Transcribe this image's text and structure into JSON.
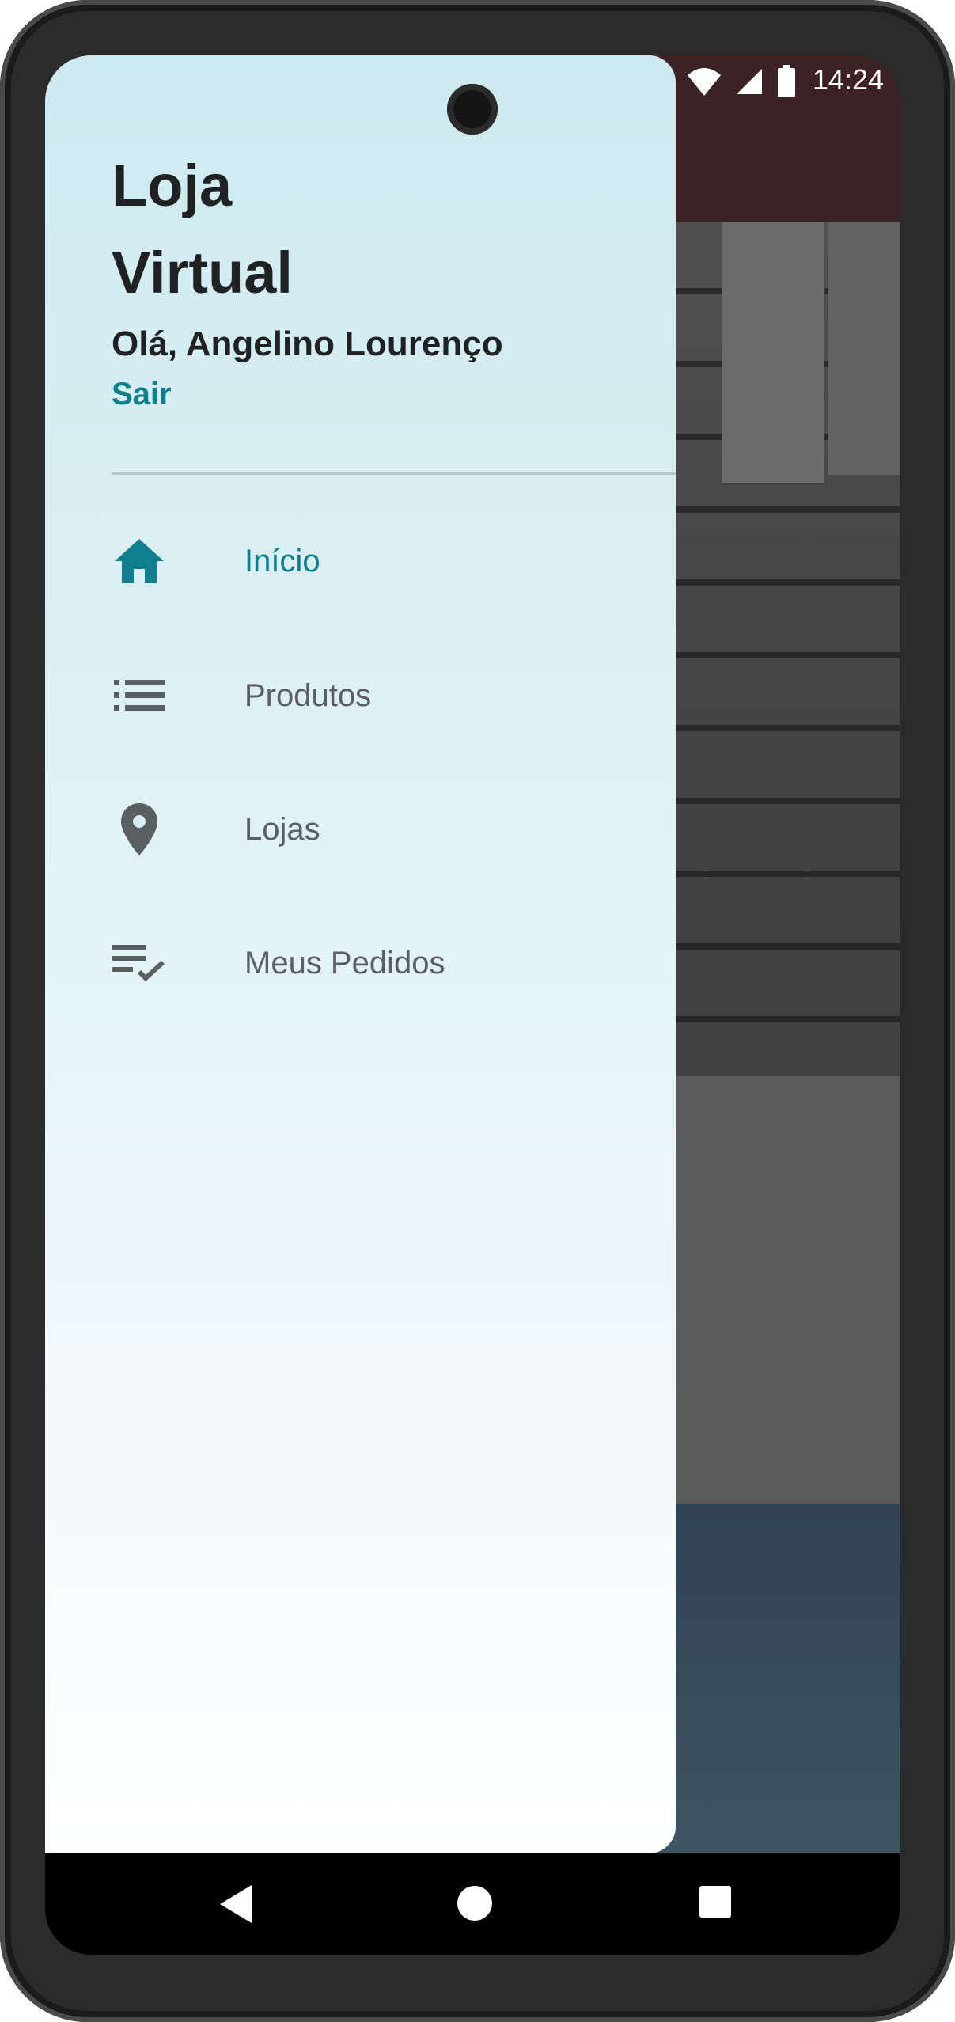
{
  "status_bar": {
    "time": "14:24",
    "icons": [
      "circle-icon",
      "calendar-icon",
      "wifi-icon",
      "signal-icon",
      "battery-icon"
    ]
  },
  "drawer": {
    "title_line1": "Loja",
    "title_line2": "Virtual",
    "greeting": "Olá, Angelino Lourenço",
    "logout_label": "Sair",
    "items": [
      {
        "label": "Início",
        "icon": "home-icon",
        "active": true
      },
      {
        "label": "Produtos",
        "icon": "list-icon",
        "active": false
      },
      {
        "label": "Lojas",
        "icon": "location-pin-icon",
        "active": false
      },
      {
        "label": "Meus Pedidos",
        "icon": "playlist-check-icon",
        "active": false
      }
    ]
  },
  "colors": {
    "accent": "#0f7f8e",
    "text_dark": "#1f2123",
    "text_muted": "#5b5f62",
    "app_bar": "#6a3b41"
  },
  "nav_bar": {
    "icons": [
      "back-icon",
      "home-circle-icon",
      "recent-apps-icon"
    ]
  }
}
